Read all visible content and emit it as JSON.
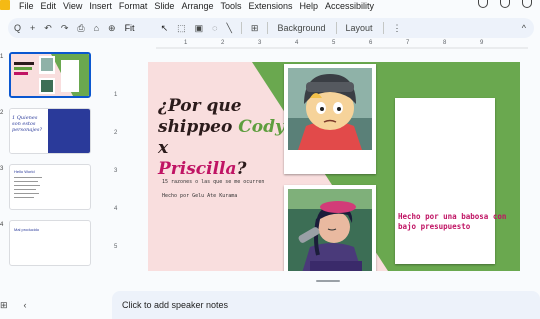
{
  "menu": [
    "File",
    "Edit",
    "View",
    "Insert",
    "Format",
    "Slide",
    "Arrange",
    "Tools",
    "Extensions",
    "Help",
    "Accessibility"
  ],
  "toolbar": {
    "search": "Q",
    "add": "+",
    "undo": "↶",
    "redo": "↷",
    "print": "⎙",
    "paint": "⌂",
    "zoom_icon": "⊕",
    "zoom": "Fit",
    "select": "↖",
    "textbox": "⬚",
    "image": "▣",
    "shape": "◌",
    "line": "╲",
    "comment": "⊞",
    "background": "Background",
    "layout": "Layout",
    "more": "⋮",
    "collapse": "^"
  },
  "thumbs": [
    {
      "num": "1"
    },
    {
      "num": "2",
      "title": "1 Quienes son estos personajes?"
    },
    {
      "num": "3",
      "title": "Hello World"
    },
    {
      "num": "4",
      "title": "Mal producido"
    }
  ],
  "ruler_top": [
    "1",
    "2",
    "3",
    "4",
    "5",
    "6",
    "7",
    "8",
    "9"
  ],
  "ruler_left": [
    "1",
    "2",
    "3",
    "4",
    "5"
  ],
  "slide": {
    "title_part1": "¿Por que",
    "title_part2": "shippeo",
    "title_cody": "Cody",
    "title_x": "x",
    "title_priscilla": "Priscilla",
    "title_q": "?",
    "subtitle": "15 razones o las que se me ocurren",
    "byline": "Hecho por Gelu Ate Kurama",
    "caption": "Hecho por una babosa con bajo presupuesto"
  },
  "notes": "Click to add speaker notes",
  "bottom": {
    "grid": "⊞",
    "back": "‹"
  },
  "colors": {
    "green": "#6aa84f",
    "pink": "#c01464",
    "slide_bg": "#f9dede",
    "accent": "#0b57d0"
  }
}
